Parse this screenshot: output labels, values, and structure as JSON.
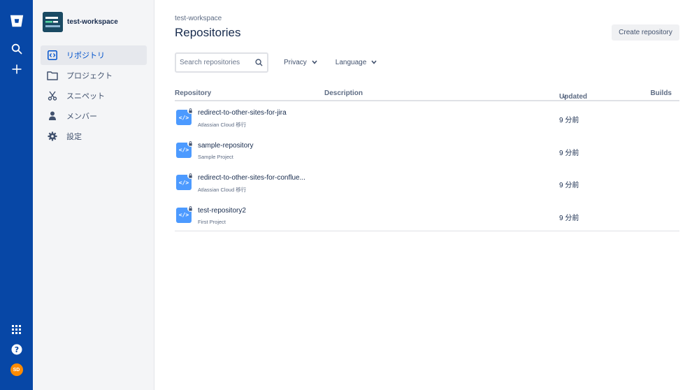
{
  "global_nav": {
    "icons": [
      "bitbucket-logo-icon",
      "search-icon",
      "plus-icon",
      "app-switcher-icon",
      "help-icon"
    ],
    "user_initials": "SD",
    "accent": "#0747a6"
  },
  "sidebar": {
    "workspace_name": "test-workspace",
    "items": [
      {
        "label": "リポジトリ",
        "icon": "repository-icon",
        "active": true
      },
      {
        "label": "プロジェクト",
        "icon": "folder-icon",
        "active": false
      },
      {
        "label": "スニペット",
        "icon": "scissors-icon",
        "active": false
      },
      {
        "label": "メンバー",
        "icon": "person-icon",
        "active": false
      },
      {
        "label": "設定",
        "icon": "gear-icon",
        "active": false
      }
    ]
  },
  "main": {
    "breadcrumb": "test-workspace",
    "title": "Repositories",
    "create_button": "Create repository",
    "search_placeholder": "Search repositories",
    "filters": {
      "privacy": "Privacy",
      "language": "Language"
    },
    "columns": {
      "repository": "Repository",
      "description": "Description",
      "updated": "Updated",
      "builds": "Builds"
    },
    "rows": [
      {
        "name": "redirect-to-other-sites-for-jira",
        "project": "Atlassian Cloud 移行",
        "updated": "9 分前"
      },
      {
        "name": "sample-repository",
        "project": "Sample Project",
        "updated": "9 分前"
      },
      {
        "name": "redirect-to-other-sites-for-conflue...",
        "project": "Atlassian Cloud 移行",
        "updated": "9 分前"
      },
      {
        "name": "test-repository2",
        "project": "First Project",
        "updated": "9 分前"
      }
    ]
  }
}
